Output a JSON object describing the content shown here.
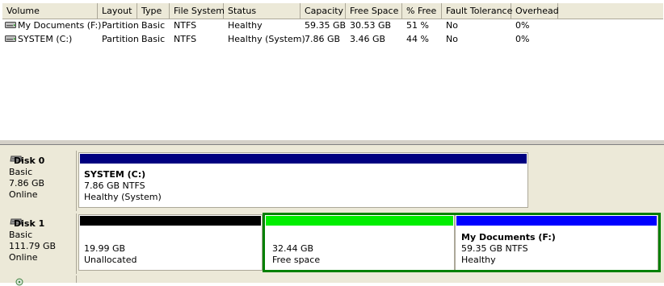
{
  "columns": [
    "Volume",
    "Layout",
    "Type",
    "File System",
    "Status",
    "Capacity",
    "Free Space",
    "% Free",
    "Fault Tolerance",
    "Overhead"
  ],
  "volumes": [
    {
      "volume": "My Documents (F:)",
      "layout": "Partition",
      "type": "Basic",
      "fs": "NTFS",
      "status": "Healthy",
      "capacity": "59.35 GB",
      "free": "30.53 GB",
      "pct": "51 %",
      "fault": "No",
      "overhead": "0%"
    },
    {
      "volume": "SYSTEM (C:)",
      "layout": "Partition",
      "type": "Basic",
      "fs": "NTFS",
      "status": "Healthy (System)",
      "capacity": "7.86 GB",
      "free": "3.46 GB",
      "pct": "44 %",
      "fault": "No",
      "overhead": "0%"
    }
  ],
  "disks": [
    {
      "name": "Disk 0",
      "type": "Basic",
      "size": "7.86 GB",
      "state": "Online",
      "partitions": [
        {
          "title": "SYSTEM  (C:)",
          "line1": "7.86 GB NTFS",
          "line2": "Healthy (System)"
        }
      ]
    },
    {
      "name": "Disk 1",
      "type": "Basic",
      "size": "111.79 GB",
      "state": "Online",
      "partitions": [
        {
          "title": "",
          "line1": "19.99 GB",
          "line2": "Unallocated"
        },
        {
          "title": "",
          "line1": "32.44 GB",
          "line2": "Free space"
        },
        {
          "title": "My Documents  (F:)",
          "line1": "59.35 GB NTFS",
          "line2": "Healthy"
        }
      ]
    }
  ],
  "colors": {
    "primary": "#000080",
    "unallocated": "#000000",
    "free_space": "#00ee00",
    "logical": "#0000ff",
    "selection": "#008000"
  },
  "icons": {
    "volume": "drive-icon",
    "disk": "disk-icon",
    "cdrom": "cdrom-icon"
  }
}
